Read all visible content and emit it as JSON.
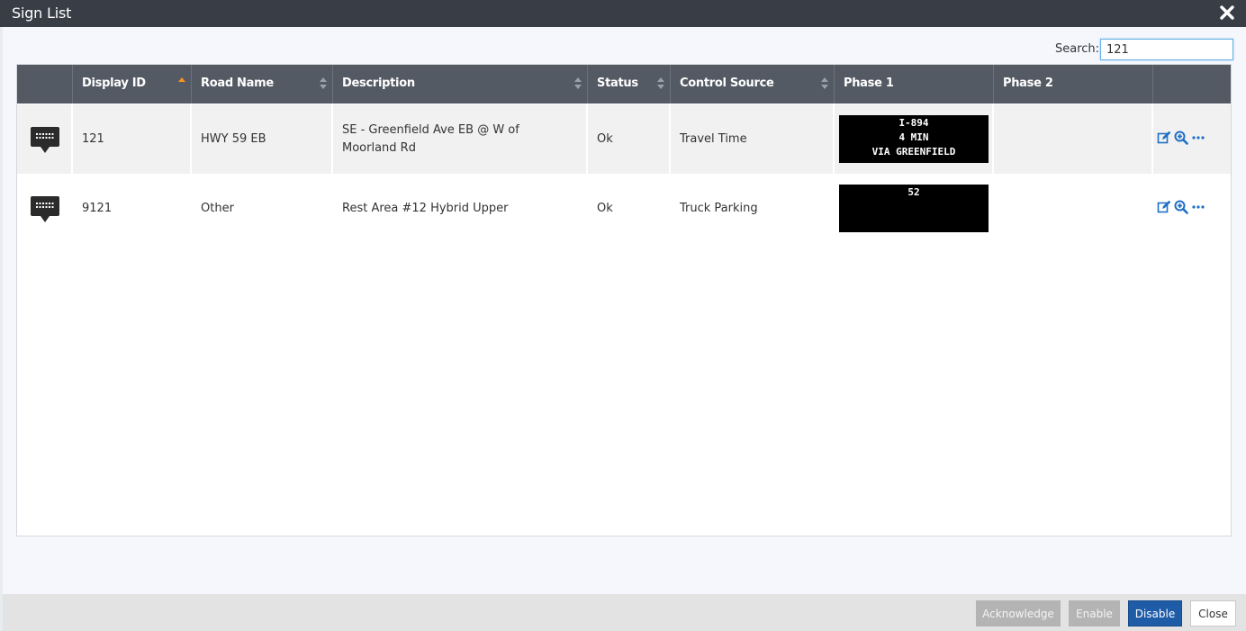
{
  "window": {
    "title": "Sign List"
  },
  "search": {
    "label": "Search:",
    "value": "121"
  },
  "table": {
    "columns": [
      {
        "label": "",
        "sort": "none"
      },
      {
        "label": "Display ID",
        "sort": "asc"
      },
      {
        "label": "Road Name",
        "sort": "both"
      },
      {
        "label": "Description",
        "sort": "both"
      },
      {
        "label": "Status",
        "sort": "both"
      },
      {
        "label": "Control Source",
        "sort": "both"
      },
      {
        "label": "Phase 1",
        "sort": "none"
      },
      {
        "label": "Phase 2",
        "sort": "none"
      },
      {
        "label": "",
        "sort": "none"
      }
    ],
    "rows": [
      {
        "icon": "message-sign-icon",
        "display_id": "121",
        "road_name": "HWY 59 EB",
        "description": "SE - Greenfield Ave EB @ W of Moorland Rd",
        "status": "Ok",
        "control_source": "Travel Time",
        "phase1": [
          "I-894",
          "4 MIN",
          "VIA GREENFIELD"
        ],
        "phase2": ""
      },
      {
        "icon": "message-sign-icon",
        "display_id": "9121",
        "road_name": "Other",
        "description": "Rest Area #12 Hybrid Upper",
        "status": "Ok",
        "control_source": "Truck Parking",
        "phase1": [
          "52",
          "",
          ""
        ],
        "phase2": ""
      }
    ]
  },
  "footer": {
    "acknowledge": "Acknowledge",
    "enable": "Enable",
    "disable": "Disable",
    "close": "Close"
  },
  "colors": {
    "titlebar": "#393e46",
    "table_header": "#545a64",
    "accent_sort": "#f7941d",
    "action_icons": "#1f6fc5",
    "primary_button": "#1f5ca8"
  }
}
